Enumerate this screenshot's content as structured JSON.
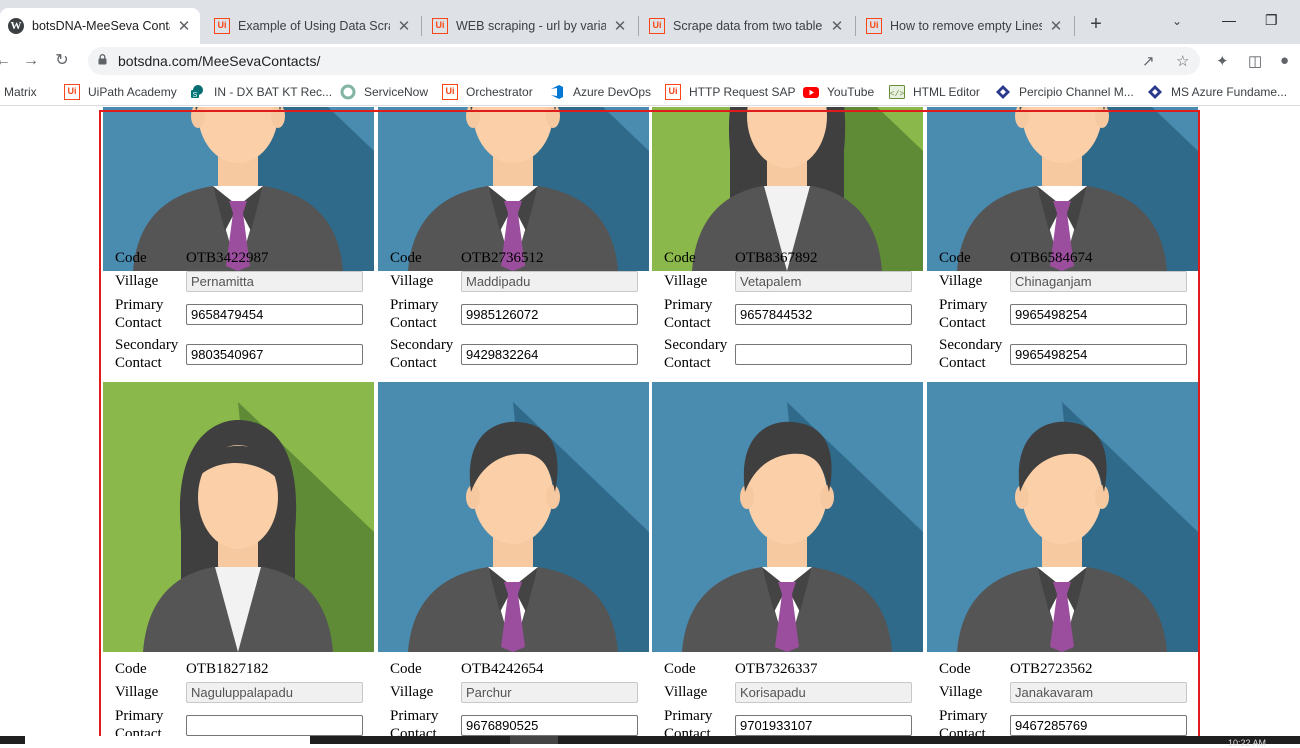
{
  "tabs": [
    {
      "title": "botsDNA-MeeSeva Contacts",
      "icon": "wordpress-icon",
      "active": true
    },
    {
      "title": "Example of Using Data Scrap",
      "icon": "uipath-icon",
      "active": false
    },
    {
      "title": "WEB scraping - url by variabl",
      "icon": "uipath-icon",
      "active": false
    },
    {
      "title": "Scrape data from two tables",
      "icon": "uipath-icon",
      "active": false
    },
    {
      "title": "How to remove empty Lines",
      "icon": "uipath-icon",
      "active": false
    }
  ],
  "address": {
    "url": "botsdna.com/MeeSevaContacts/"
  },
  "bookmarks": [
    {
      "label": "Matrix",
      "icon": "bookmark-icon"
    },
    {
      "label": "UiPath Academy",
      "icon": "uipath-icon"
    },
    {
      "label": "IN - DX BAT KT Rec...",
      "icon": "sharepoint-icon"
    },
    {
      "label": "ServiceNow",
      "icon": "servicenow-icon"
    },
    {
      "label": "Orchestrator",
      "icon": "uipath-icon"
    },
    {
      "label": "Azure DevOps",
      "icon": "azure-devops-icon"
    },
    {
      "label": "HTTP Request SAP",
      "icon": "uipath-icon"
    },
    {
      "label": "YouTube",
      "icon": "youtube-icon"
    },
    {
      "label": "HTML Editor",
      "icon": "html-editor-icon"
    },
    {
      "label": "Percipio Channel M...",
      "icon": "percipio-icon"
    },
    {
      "label": "MS Azure Fundame...",
      "icon": "percipio-icon"
    }
  ],
  "labels": {
    "code": "Code",
    "village": "Village",
    "primary_1": "Primary",
    "primary_2": "Contact",
    "secondary_1": "Secondary",
    "secondary_2": "Contact"
  },
  "cards": [
    {
      "code": "OTB3422987",
      "village": "Pernamitta",
      "primary": "9658479454",
      "secondary": "9803540967",
      "avatar": "male"
    },
    {
      "code": "OTB2736512",
      "village": "Maddipadu",
      "primary": "9985126072",
      "secondary": "9429832264",
      "avatar": "male"
    },
    {
      "code": "OTB8367892",
      "village": "Vetapalem",
      "primary": "9657844532",
      "secondary": "",
      "avatar": "female"
    },
    {
      "code": "OTB6584674",
      "village": "Chinaganjam",
      "primary": "9965498254",
      "secondary": "9965498254",
      "avatar": "male"
    },
    {
      "code": "OTB1827182",
      "village": "Naguluppalapadu",
      "primary": "",
      "secondary": "",
      "avatar": "female"
    },
    {
      "code": "OTB4242654",
      "village": "Parchur",
      "primary": "9676890525",
      "secondary": "",
      "avatar": "male"
    },
    {
      "code": "OTB7326337",
      "village": "Korisapadu",
      "primary": "9701933107",
      "secondary": "",
      "avatar": "male"
    },
    {
      "code": "OTB2723562",
      "village": "Janakavaram",
      "primary": "9467285769",
      "secondary": "",
      "avatar": "male"
    }
  ],
  "colors": {
    "male_bg": "#4a8bb0",
    "male_shadow": "#2f6a8a",
    "female_bg": "#8ab84a",
    "female_shadow": "#5f8a36",
    "highlight": "#e01b1b"
  },
  "taskbar": {
    "clock": "10:22 AM"
  }
}
